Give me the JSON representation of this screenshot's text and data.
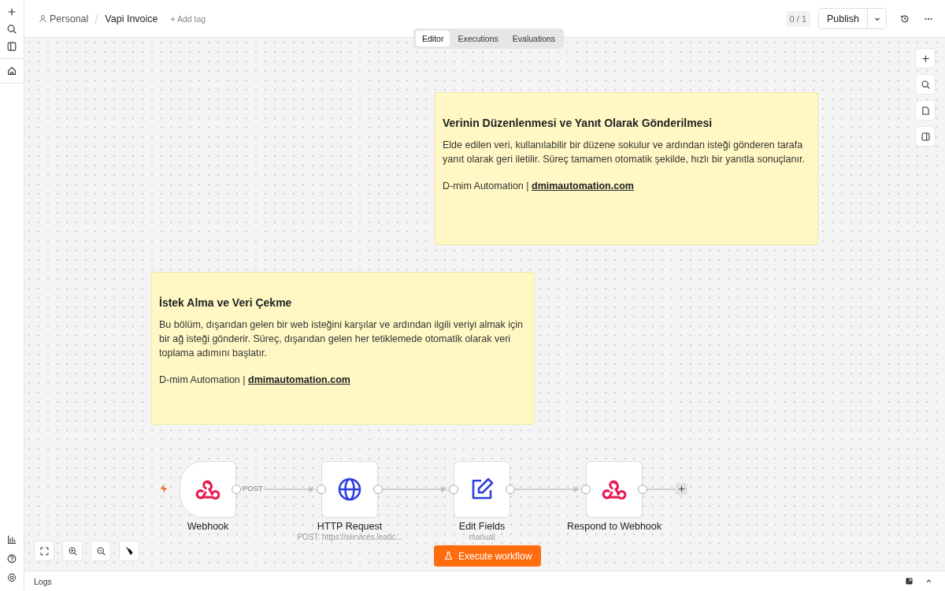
{
  "header": {
    "project": "Personal",
    "workflow": "Vapi Invoice",
    "add_tag": "+ Add tag",
    "counter": "0 / 1",
    "publish": "Publish"
  },
  "view_tabs": [
    {
      "label": "Editor",
      "selected": true
    },
    {
      "label": "Executions",
      "selected": false
    },
    {
      "label": "Evaluations",
      "selected": false
    }
  ],
  "sticky_notes": [
    {
      "title": "Verinin Düzenlenmesi ve Yanıt Olarak Gönderilmesi",
      "body": "Elde edilen veri, kullanılabilir bir düzene sokulur ve ardından isteği gönderen tarafa yanıt olarak geri iletilir. Süreç tamamen otomatik şekilde, hızlı bir yanıtla sonuçlanır.",
      "credit": "D-mim Automation | ",
      "link": "dmimautomation.com"
    },
    {
      "title": "İstek Alma ve Veri Çekme",
      "body": "Bu bölüm, dışarıdan gelen bir web isteğini karşılar ve ardından ilgili veriyi almak için bir ağ isteği gönderir. Süreç, dışarıdan gelen her tetiklemede otomatik olarak veri toplama adımını başlatır.",
      "credit": "D-mim Automation | ",
      "link": "dmimautomation.com"
    }
  ],
  "nodes": [
    {
      "kind": "webhook",
      "name": "Webhook",
      "trigger": true,
      "edge_label": "POST"
    },
    {
      "kind": "http",
      "name": "HTTP Request",
      "subtitle": "POST: https://services.leadc..."
    },
    {
      "kind": "edit",
      "name": "Edit Fields",
      "subtitle": "manual"
    },
    {
      "kind": "webhook",
      "name": "Respond to Webhook"
    }
  ],
  "execute_button": "Execute workflow",
  "logs": {
    "label": "Logs"
  }
}
